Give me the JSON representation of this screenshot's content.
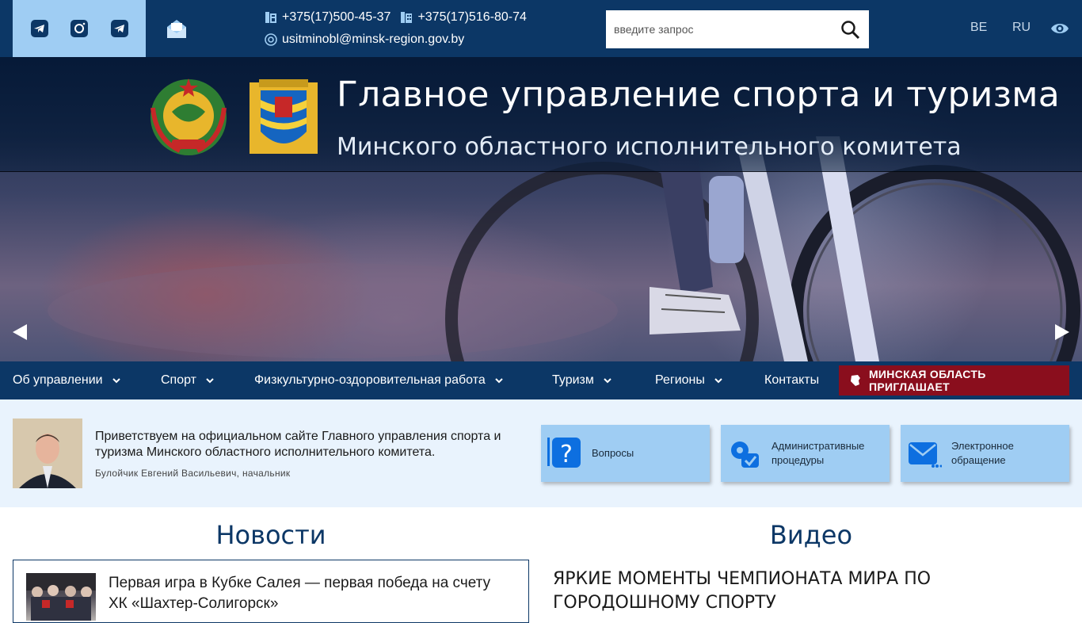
{
  "topbar": {
    "social_icons": [
      "telegram-icon",
      "instagram-icon",
      "telegram-icon"
    ],
    "mail_icon": "open-mail-icon",
    "phone1": "+375(17)500-45-37",
    "phone2": "+375(17)516-80-74",
    "email": "usitminobl@minsk-region.gov.by",
    "search_placeholder": "введите запрос",
    "lang_be": "BE",
    "lang_ru": "RU",
    "accessibility_icon": "eye-icon"
  },
  "banner": {
    "title": "Главное управление спорта и туризма",
    "subtitle": "Минского областного исполнительного комитета"
  },
  "nav": {
    "items": [
      {
        "label": "Об управлении"
      },
      {
        "label": "Спорт"
      },
      {
        "label": "Физкультурно-оздоровительная работа"
      },
      {
        "label": "Туризм"
      },
      {
        "label": "Регионы"
      },
      {
        "label": "Контакты"
      }
    ],
    "invite": "МИНСКАЯ ОБЛАСТЬ ПРИГЛАШАЕТ"
  },
  "welcome": {
    "text": "Приветствуем на официальном сайте Главного управления спорта и туризма Минского областного исполнительного комитета.",
    "signature": "Булойчик Евгений  Васильевич, начальник",
    "tiles": [
      {
        "label": "Вопросы",
        "icon": "question-icon"
      },
      {
        "label": "Административные процедуры",
        "icon": "admin-procedures-icon"
      },
      {
        "label": "Электронное обращение",
        "icon": "email-appeal-icon"
      }
    ]
  },
  "news": {
    "heading": "Новости",
    "items": [
      {
        "title": "Первая игра в Кубке Салея — первая победа на счету ХК «Шахтер-Солигорск»"
      }
    ]
  },
  "video": {
    "heading": "Видео",
    "title": "ЯРКИЕ МОМЕНТЫ ЧЕМПИОНАТА МИРА ПО ГОРОДОШНОМУ СПОРТУ"
  },
  "colors": {
    "primary": "#0c3766",
    "accent_light": "#9fcdf3",
    "welcome_bg": "#e9f3fd",
    "invite": "#8a0e1d"
  }
}
